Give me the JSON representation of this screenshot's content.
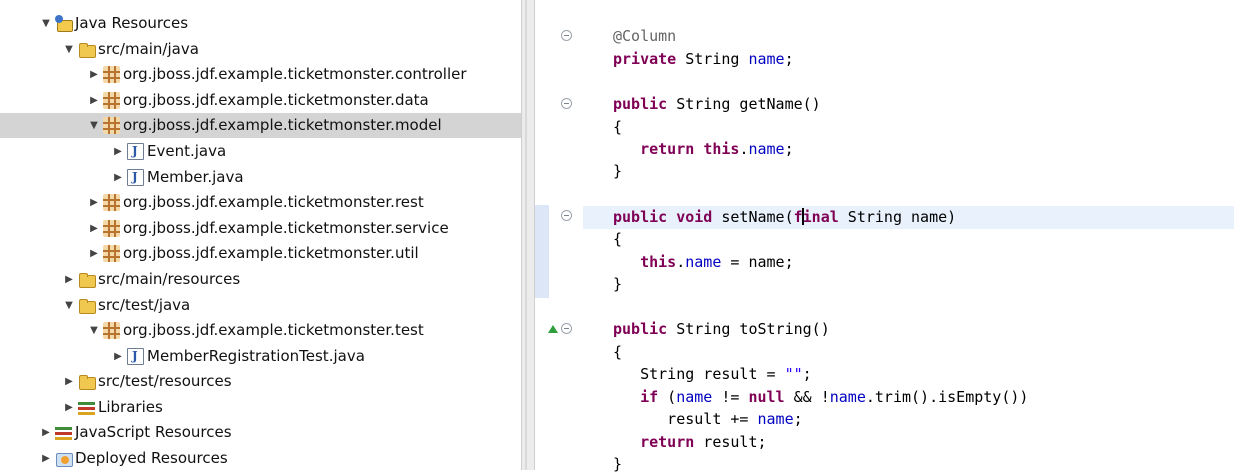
{
  "tree": {
    "items": [
      {
        "label": "Java Resources",
        "icon": "project-icon",
        "expanded": true
      },
      {
        "label": "src/main/java",
        "icon": "source-folder-icon",
        "expanded": true
      },
      {
        "label": "org.jboss.jdf.example.ticketmonster.controller",
        "icon": "package-icon",
        "expanded": false
      },
      {
        "label": "org.jboss.jdf.example.ticketmonster.data",
        "icon": "package-icon",
        "expanded": false
      },
      {
        "label": "org.jboss.jdf.example.ticketmonster.model",
        "icon": "package-icon",
        "expanded": true,
        "selected": true
      },
      {
        "label": "Event.java",
        "icon": "java-file-icon",
        "expanded": false
      },
      {
        "label": "Member.java",
        "icon": "java-file-icon",
        "expanded": false
      },
      {
        "label": "org.jboss.jdf.example.ticketmonster.rest",
        "icon": "package-icon",
        "expanded": false
      },
      {
        "label": "org.jboss.jdf.example.ticketmonster.service",
        "icon": "package-icon",
        "expanded": false
      },
      {
        "label": "org.jboss.jdf.example.ticketmonster.util",
        "icon": "package-icon",
        "expanded": false
      },
      {
        "label": "src/main/resources",
        "icon": "source-folder-icon",
        "expanded": false
      },
      {
        "label": "src/test/java",
        "icon": "source-folder-icon",
        "expanded": true
      },
      {
        "label": "org.jboss.jdf.example.ticketmonster.test",
        "icon": "package-icon",
        "expanded": true
      },
      {
        "label": "MemberRegistrationTest.java",
        "icon": "java-file-icon",
        "expanded": false
      },
      {
        "label": "src/test/resources",
        "icon": "source-folder-icon",
        "expanded": false
      },
      {
        "label": "Libraries",
        "icon": "libraries-icon",
        "expanded": false
      },
      {
        "label": "JavaScript Resources",
        "icon": "libraries-icon",
        "expanded": false
      },
      {
        "label": "Deployed Resources",
        "icon": "deployed-resources-icon",
        "expanded": false
      }
    ]
  },
  "editor": {
    "lines": [
      [
        {
          "t": "@Column",
          "c": "ann"
        }
      ],
      [
        {
          "t": "private",
          "c": "kw"
        },
        {
          "t": " String "
        },
        {
          "t": "name",
          "c": "fld"
        },
        {
          "t": ";"
        }
      ],
      [],
      [
        {
          "t": "public",
          "c": "kw"
        },
        {
          "t": " String getName()"
        }
      ],
      [
        {
          "t": "{"
        }
      ],
      [
        {
          "t": "   "
        },
        {
          "t": "return",
          "c": "kw"
        },
        {
          "t": " "
        },
        {
          "t": "this",
          "c": "kw"
        },
        {
          "t": "."
        },
        {
          "t": "name",
          "c": "fld"
        },
        {
          "t": ";"
        }
      ],
      [
        {
          "t": "}"
        }
      ],
      [],
      [
        {
          "t": "public",
          "c": "kw"
        },
        {
          "t": " "
        },
        {
          "t": "void",
          "c": "kw"
        },
        {
          "t": " setName("
        },
        {
          "t": "f",
          "c": "kw"
        },
        {
          "caret": true
        },
        {
          "t": "inal",
          "c": "kw"
        },
        {
          "t": " String name)"
        }
      ],
      [
        {
          "t": "{"
        }
      ],
      [
        {
          "t": "   "
        },
        {
          "t": "this",
          "c": "kw"
        },
        {
          "t": "."
        },
        {
          "t": "name",
          "c": "fld"
        },
        {
          "t": " = name;"
        }
      ],
      [
        {
          "t": "}"
        }
      ],
      [],
      [
        {
          "t": "public",
          "c": "kw"
        },
        {
          "t": " String toString()"
        }
      ],
      [
        {
          "t": "{"
        }
      ],
      [
        {
          "t": "   String result = "
        },
        {
          "t": "\"\"",
          "c": "str"
        },
        {
          "t": ";"
        }
      ],
      [
        {
          "t": "   "
        },
        {
          "t": "if",
          "c": "kw"
        },
        {
          "t": " ("
        },
        {
          "t": "name",
          "c": "fld"
        },
        {
          "t": " != "
        },
        {
          "t": "null",
          "c": "kw"
        },
        {
          "t": " && !"
        },
        {
          "t": "name",
          "c": "fld"
        },
        {
          "t": ".trim().isEmpty())"
        }
      ],
      [
        {
          "t": "      result += "
        },
        {
          "t": "name",
          "c": "fld"
        },
        {
          "t": ";"
        }
      ],
      [
        {
          "t": "   "
        },
        {
          "t": "return",
          "c": "kw"
        },
        {
          "t": " result;"
        }
      ],
      [
        {
          "t": "}"
        }
      ]
    ]
  }
}
